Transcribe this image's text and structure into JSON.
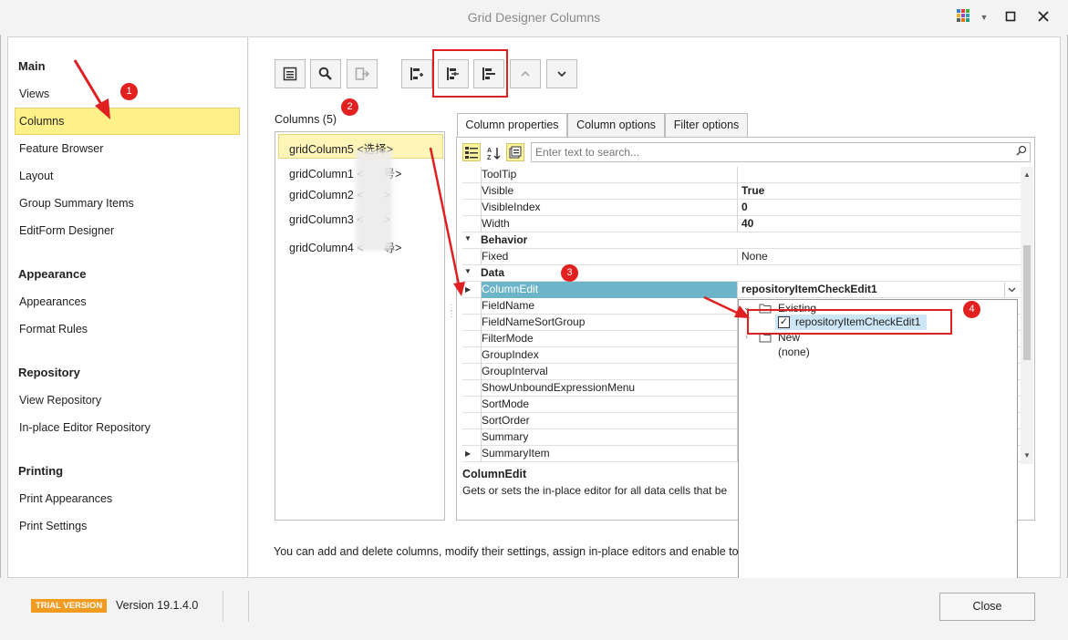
{
  "window": {
    "title": "Grid Designer Columns"
  },
  "nav": {
    "groups": [
      {
        "heading": "Main",
        "items": [
          "Views",
          "Columns",
          "Feature Browser",
          "Layout",
          "Group Summary Items",
          "EditForm Designer"
        ]
      },
      {
        "heading": "Appearance",
        "items": [
          "Appearances",
          "Format Rules"
        ]
      },
      {
        "heading": "Repository",
        "items": [
          "View Repository",
          "In-place Editor Repository"
        ]
      },
      {
        "heading": "Printing",
        "items": [
          "Print Appearances",
          "Print Settings"
        ]
      }
    ],
    "selected": "Columns"
  },
  "columns": {
    "header": "Columns (5)",
    "items": [
      "gridColumn5 <选择>",
      "gridColumn1 <",
      "gridColumn2 <",
      "gridColumn3 <",
      "gridColumn4 <"
    ],
    "item_suffixes": [
      "",
      "号>",
      ">",
      ">",
      "尋>"
    ]
  },
  "tabs": [
    "Column properties",
    "Column options",
    "Filter options"
  ],
  "search": {
    "placeholder": "Enter text to search..."
  },
  "properties": [
    {
      "name": "ToolTip",
      "value": ""
    },
    {
      "name": "Visible",
      "value": "True",
      "bold": true
    },
    {
      "name": "VisibleIndex",
      "value": "0",
      "bold": true
    },
    {
      "name": "Width",
      "value": "40",
      "bold": true
    },
    {
      "category": "Behavior"
    },
    {
      "name": "Fixed",
      "value": "None"
    },
    {
      "category": "Data"
    },
    {
      "name": "ColumnEdit",
      "value": "repositoryItemCheckEdit1",
      "bold": true,
      "selected": true
    },
    {
      "name": "FieldName",
      "value": ""
    },
    {
      "name": "FieldNameSortGroup",
      "value": ""
    },
    {
      "name": "FilterMode",
      "value": ""
    },
    {
      "name": "GroupIndex",
      "value": ""
    },
    {
      "name": "GroupInterval",
      "value": ""
    },
    {
      "name": "ShowUnboundExpressionMenu",
      "value": ""
    },
    {
      "name": "SortMode",
      "value": ""
    },
    {
      "name": "SortOrder",
      "value": ""
    },
    {
      "name": "Summary",
      "value": ""
    },
    {
      "name": "SummaryItem",
      "value": ""
    }
  ],
  "description": {
    "title": "ColumnEdit",
    "text": "Gets or sets the in-place editor for all data cells that be"
  },
  "dropdown": {
    "existing": "Existing",
    "item": "repositoryItemCheckEdit1",
    "new": "New",
    "none": "(none)"
  },
  "hint": "You can add and delete columns, modify their settings, assign in-place editors and enable tot",
  "footer": {
    "trial": "TRIAL VERSION",
    "version": "Version 19.1.4.0",
    "close": "Close"
  },
  "annotations": [
    "1",
    "2",
    "3",
    "4"
  ],
  "colors": {
    "selection_yellow": "#fff08a",
    "selected_row": "#6cb4c8",
    "annotation_red": "#e32020",
    "trial_orange": "#f29b21"
  }
}
